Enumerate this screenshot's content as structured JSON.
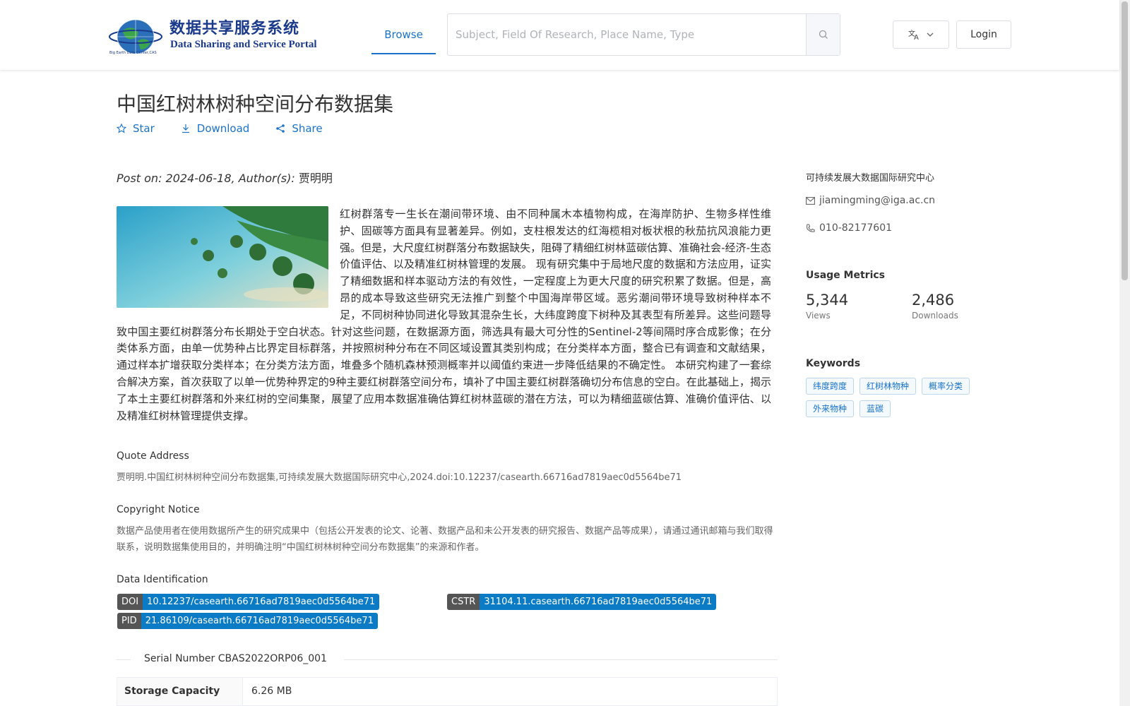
{
  "header": {
    "logo_cn": "数据共享服务系统",
    "logo_en": "Data Sharing and Service Portal",
    "logo_tag": "Big Earth Data Center,CAS",
    "nav_browse": "Browse",
    "search_placeholder": "Subject, Field Of Research, Place Name, Type",
    "login_label": "Login"
  },
  "dataset": {
    "title": "中国红树林树种空间分布数据集",
    "actions": {
      "star": "Star",
      "download": "Download",
      "share": "Share"
    },
    "post_on_label": "Post on: 2024-06-18, Author(s): ",
    "author": "贾明明",
    "abstract": "红树群落专一生长在潮间带环境、由不同种属木本植物构成，在海岸防护、生物多样性维护、固碳等方面具有显著差异。例如，支柱根发达的红海榄相对板状根的秋茄抗风浪能力更强。但是，大尺度红树群落分布数据缺失，阻碍了精细红树林蓝碳估算、准确社会-经济-生态价值评估、以及精准红树林管理的发展。 现有研究集中于局地尺度的数据和方法应用，证实了精细数据和样本驱动方法的有效性，一定程度上为更大尺度的研究积累了数据。但是，高昂的成本导致这些研究无法推广到整个中国海岸带区域。恶劣潮间带环境导致树种样本不足，不同树种协同进化导致其混杂生长，大纬度跨度下树种及其表型有所差异。这些问题导致中国主要红树群落分布长期处于空白状态。针对这些问题，在数据源方面，筛选具有最大可分性的Sentinel-2等间隔时序合成影像；在分类体系方面，由单一优势种占比界定目标群落，并按照树种分布在不同区域设置其类别构成；在分类样本方面，整合已有调查和文献结果，通过样本扩增获取分类样本；在分类方法方面，堆叠多个随机森林预测概率并以阈值约束进一步降低结果的不确定性。 本研究构建了一套综合解决方案，首次获取了以单一优势种界定的9种主要红树群落空间分布，填补了中国主要红树群落确切分布信息的空白。在此基础上，揭示了本土主要红树群落和外来红树的空间集聚，展望了应用本数据准确估算红树林蓝碳的潜在方法，可以为精细蓝碳估算、准确价值评估、以及精准红树林管理提供支撑。"
  },
  "quote": {
    "heading": "Quote Address",
    "text": "贾明明.中国红树林树种空间分布数据集,可持续发展大数据国际研究中心,2024.doi:10.12237/casearth.66716ad7819aec0d5564be71"
  },
  "copyright": {
    "heading": "Copyright Notice",
    "text": "数据产品使用者在使用数据所产生的研究成果中（包括公开发表的论文、论著、数据产品和未公开发表的研究报告、数据产品等成果），请通过通讯邮箱与我们取得联系，说明数据集使用目的，并明确注明“中国红树林树种空间分布数据集”的来源和作者。"
  },
  "identification": {
    "heading": "Data Identification",
    "doi_key": "DOI",
    "doi_value": "10.12237/casearth.66716ad7819aec0d5564be71",
    "cstr_key": "CSTR",
    "cstr_value": "31104.11.casearth.66716ad7819aec0d5564be71",
    "pid_key": "PID",
    "pid_value": "21.86109/casearth.66716ad7819aec0d5564be71"
  },
  "serial": "Serial Number CBAS2022ORP06_001",
  "storage": {
    "label": "Storage Capacity",
    "value": "6.26 MB"
  },
  "sidebar": {
    "org": "可持续发展大数据国际研究中心",
    "email": "jiamingming@iga.ac.cn",
    "phone": "010-82177601",
    "metrics_heading": "Usage Metrics",
    "views_value": "5,344",
    "views_label": "Views",
    "downloads_value": "2,486",
    "downloads_label": "Downloads",
    "keywords_heading": "Keywords",
    "keywords": [
      "纬度跨度",
      "红树林物种",
      "概率分类",
      "外来物种",
      "蓝碳"
    ]
  },
  "icons": {
    "search": "search-icon",
    "translate": "translate-icon",
    "star": "star-icon",
    "download": "download-icon",
    "share": "share-icon",
    "mail": "mail-icon",
    "phone": "phone-icon"
  },
  "colors": {
    "accent": "#1a73c9",
    "tag_value": "#0a7bc4",
    "tag_key": "#555555"
  }
}
